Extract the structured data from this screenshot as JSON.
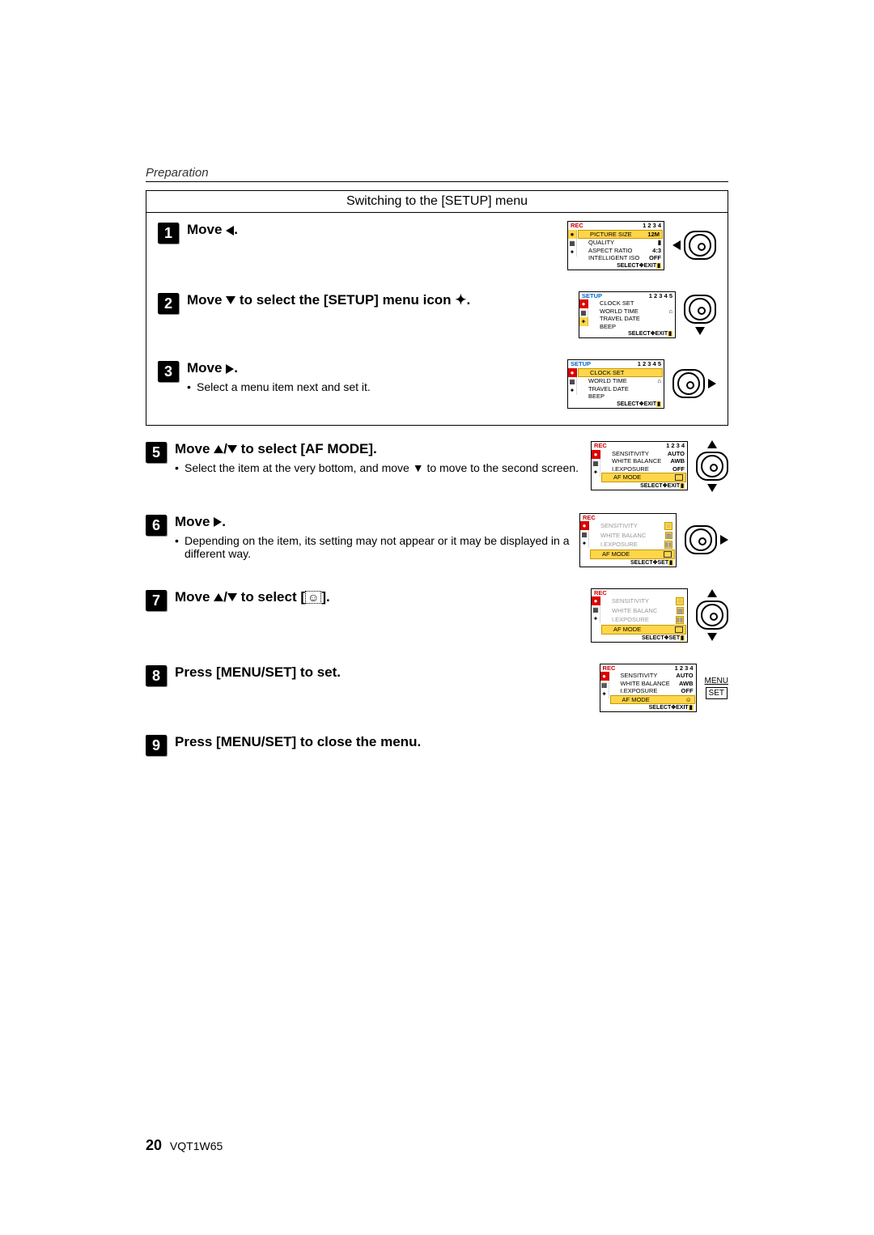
{
  "section": "Preparation",
  "page_number": "20",
  "doc_code": "VQT1W65",
  "setup": {
    "header": "Switching to the [SETUP] menu",
    "steps": {
      "s1": {
        "num": "1",
        "title_a": "Move ",
        "title_b": "."
      },
      "s2": {
        "num": "2",
        "title_a": "Move ",
        "title_b": " to select the [SETUP] menu icon ",
        "title_c": "."
      },
      "s3": {
        "num": "3",
        "title_a": "Move ",
        "title_b": ".",
        "bullet": "Select a menu item next and set it."
      }
    }
  },
  "lower_steps": {
    "s5": {
      "num": "5",
      "title_a": "Move ",
      "title_b": "/",
      "title_c": " to select [AF MODE].",
      "bullet": "Select the item at the very bottom, and move ▼ to move to the second screen."
    },
    "s6": {
      "num": "6",
      "title_a": "Move ",
      "title_b": ".",
      "bullet": "Depending on the item, its setting may not appear or it may be displayed in a different way."
    },
    "s7": {
      "num": "7",
      "title_a": "Move ",
      "title_b": "/",
      "title_c": " to select [",
      "title_d": "]."
    },
    "s8": {
      "num": "8",
      "title": "Press [MENU/SET] to set."
    },
    "s9": {
      "num": "9",
      "title": "Press [MENU/SET] to close the menu."
    }
  },
  "menu_set": {
    "top": "MENU",
    "bottom": "SET"
  },
  "screens": {
    "rec1": {
      "title": "REC",
      "pages": "1 2 3 4",
      "rows": [
        {
          "label": "PICTURE SIZE",
          "val": "12M"
        },
        {
          "label": "QUALITY",
          "val": "▮"
        },
        {
          "label": "ASPECT RATIO",
          "val": "4:3"
        },
        {
          "label": "INTELLIGENT ISO",
          "val": "OFF"
        }
      ],
      "footer_a": "SELECT",
      "footer_b": "EXIT"
    },
    "setup1": {
      "title": "SETUP",
      "pages": "1 2 3 4 5",
      "rows": [
        {
          "label": "CLOCK SET",
          "val": ""
        },
        {
          "label": "WORLD TIME",
          "val": "⌂"
        },
        {
          "label": "TRAVEL DATE",
          "val": ""
        },
        {
          "label": "BEEP",
          "val": ""
        }
      ],
      "footer_a": "SELECT",
      "footer_b": "EXIT"
    },
    "setup2": {
      "title": "SETUP",
      "pages": "1 2 3 4 5",
      "hl_row": "CLOCK SET",
      "rows": [
        {
          "label": "WORLD TIME",
          "val": "⌂"
        },
        {
          "label": "TRAVEL DATE",
          "val": ""
        },
        {
          "label": "BEEP",
          "val": ""
        }
      ],
      "footer_a": "SELECT",
      "footer_b": "EXIT"
    },
    "rec2": {
      "title": "REC",
      "pages": "1 2 3 4",
      "rows": [
        {
          "label": "SENSITIVITY",
          "val": "AUTO"
        },
        {
          "label": "WHITE BALANCE",
          "val": "AWB"
        },
        {
          "label": "I.EXPOSURE",
          "val": "OFF"
        }
      ],
      "hl": {
        "label": "AF MODE",
        "val": "□"
      },
      "footer_a": "SELECT",
      "footer_b": "EXIT"
    },
    "rec3": {
      "title": "REC",
      "rows": [
        {
          "label": "SENSITIVITY",
          "val": "☺"
        },
        {
          "label": "WHITE BALANC",
          "val": "▦"
        },
        {
          "label": "I.EXPOSURE",
          "val": "▮▮"
        }
      ],
      "hl": {
        "label": "AF MODE",
        "val": "□"
      },
      "footer_a": "SELECT",
      "footer_b": "SET"
    },
    "rec4": {
      "title": "REC",
      "rows": [
        {
          "label": "SENSITIVITY",
          "val": "☺"
        },
        {
          "label": "WHITE BALANC",
          "val": "▦"
        },
        {
          "label": "I.EXPOSURE",
          "val": "▮▮"
        }
      ],
      "hl": {
        "label": "AF MODE",
        "val": "□"
      },
      "footer_a": "SELECT",
      "footer_b": "SET"
    },
    "rec5": {
      "title": "REC",
      "pages": "1 2 3 4",
      "rows": [
        {
          "label": "SENSITIVITY",
          "val": "AUTO"
        },
        {
          "label": "WHITE BALANCE",
          "val": "AWB"
        },
        {
          "label": "I.EXPOSURE",
          "val": "OFF"
        }
      ],
      "hl": {
        "label": "AF MODE",
        "val": "☺"
      },
      "footer_a": "SELECT",
      "footer_b": "EXIT"
    }
  }
}
